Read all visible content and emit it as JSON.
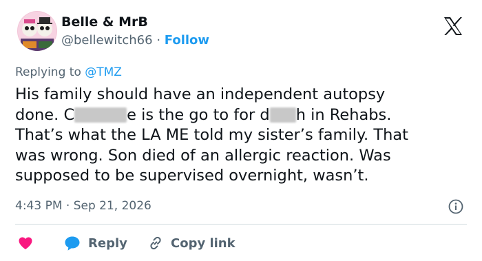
{
  "author": {
    "name": "Belle & MrB",
    "handle": "@bellewitch66",
    "separator": "·",
    "follow_label": "Follow"
  },
  "reply_context": {
    "prefix": "Replying to ",
    "mention": "@TMZ"
  },
  "tweet": {
    "line1": "His family should have an independent autopsy",
    "line2_a": "done.  C",
    "line2_b": "e is the go to for d",
    "line2_c": "h in Rehabs.",
    "line3": "That’s what the LA ME told my sister’s family. That",
    "line4": "was wrong. Son died of an allergic reaction. Was",
    "line5": "supposed to be supervised overnight, wasn’t."
  },
  "meta": {
    "timestamp": "4:43 PM · Sep 21, 2026"
  },
  "actions": {
    "reply_label": "Reply",
    "copy_label": "Copy link"
  },
  "colors": {
    "link_blue": "#1d9bf0",
    "like_red": "#f91880",
    "muted_gray": "#536471"
  }
}
